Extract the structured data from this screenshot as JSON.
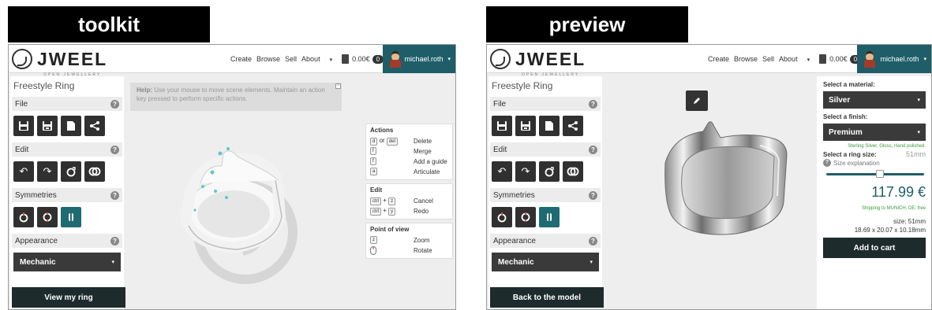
{
  "labels": {
    "left": "toolkit",
    "right": "preview"
  },
  "brand": {
    "name": "JWEEL",
    "tagline": "OPEN JEWELLERY"
  },
  "nav": {
    "create": "Create",
    "browse": "Browse",
    "sell": "Sell",
    "about": "About",
    "cart_amount": "0.00€",
    "cart_count": "0",
    "username": "michael.roth"
  },
  "sidebar": {
    "title": "Freestyle Ring",
    "sections": {
      "file": "File",
      "edit": "Edit",
      "symmetries": "Symmetries",
      "appearance": "Appearance"
    },
    "help_glyph": "?",
    "appearance_value": "Mechanic"
  },
  "toolkit": {
    "view_button": "View my ring",
    "help_bold": "Help:",
    "help_text": "Use your mouse to move scene elements. Maintain an action key pressed to perform specific actions.",
    "actions_panel": {
      "actions_title": "Actions",
      "delete_keys": "d or del",
      "delete_key_d": "d",
      "delete_or": "or",
      "delete_key_del": "del",
      "delete_label": "Delete",
      "merge_key": "f",
      "merge_label": "Merge",
      "guide_key": "f",
      "guide_label": "Add a guide",
      "articulate_key": "a",
      "articulate_label": "Articulate",
      "edit_title": "Edit",
      "ctrl": "ctrl",
      "plus": "+",
      "cancel_key": "z",
      "cancel_label": "Cancel",
      "redo_key": "y",
      "redo_label": "Redo",
      "pov_title": "Point of view",
      "zoom_key": "z",
      "zoom_label": "Zoom",
      "rotate_label": "Rotate"
    }
  },
  "preview": {
    "back_button": "Back to the model",
    "material_label": "Select a material:",
    "material_value": "Silver",
    "finish_label": "Select a finish:",
    "finish_value": "Premium",
    "finish_note": "Sterling Silver, Gloss, Hand polished.",
    "size_label": "Select a ring size:",
    "size_value": "51mm",
    "size_explanation": "Size explanation",
    "size_slider_fraction": 0.55,
    "price_main": "117",
    "price_cents": ".99 €",
    "shipping": "Shipping to MUNICH, DE: free",
    "size_line": "size: 51mm",
    "dimensions": "18.69 x 20.07 x 10.18mm",
    "cart_button": "Add to cart"
  },
  "colors": {
    "teal": "#1f5e68",
    "dark_button": "#1d2b2d",
    "active_tool": "#1f6b74",
    "green_text": "#3a9a3a"
  },
  "icons": [
    "save-icon",
    "save-as-icon",
    "new-file-icon",
    "share-icon",
    "undo-icon",
    "redo-icon",
    "ring-add-icon",
    "rings-merge-icon",
    "symmetry-none-icon",
    "symmetry-radial-icon",
    "symmetry-mirror-icon",
    "pen-icon",
    "shopping-bag-icon",
    "mouse-icon"
  ]
}
